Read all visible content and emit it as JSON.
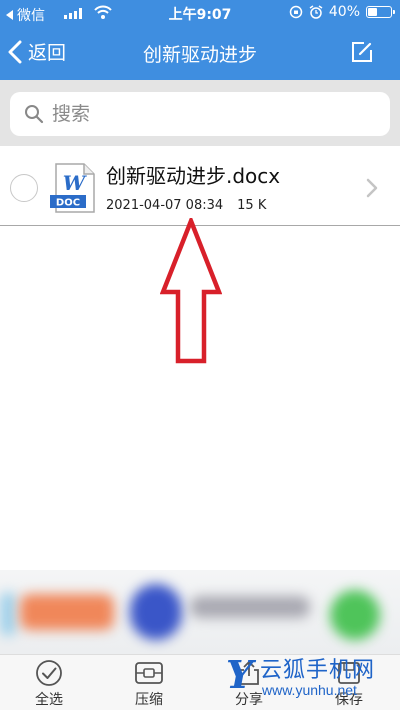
{
  "status_bar": {
    "back_app": "微信",
    "time": "上午9:07",
    "battery": "40%",
    "battery_level": 0.4
  },
  "nav": {
    "back_label": "返回",
    "title": "创新驱动进步"
  },
  "search": {
    "placeholder": "搜索"
  },
  "files": [
    {
      "name": "创新驱动进步.docx",
      "date": "2021-04-07 08:34",
      "size": "15 K",
      "icon_badge": "DOC",
      "icon_letter": "W"
    }
  ],
  "toolbar": {
    "select_all": "全选",
    "compress": "压缩",
    "share": "分享",
    "save": "保存"
  },
  "watermark": {
    "letter": "Y",
    "text": "云狐手机网",
    "url": "www.yunhu.net"
  },
  "colors": {
    "accent": "#3f8ee0",
    "annotation_arrow": "#d8202a"
  }
}
